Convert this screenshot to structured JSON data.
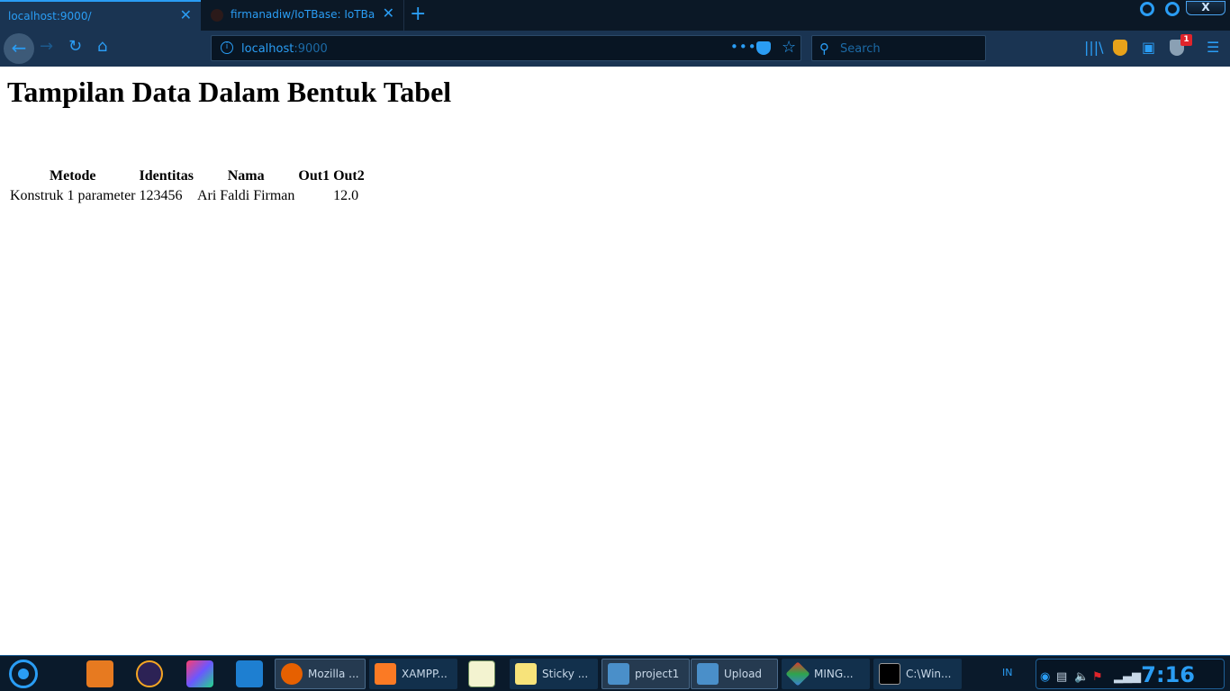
{
  "browser": {
    "tabs": [
      {
        "label": "localhost:9000/",
        "active": true
      },
      {
        "label": "firmanadiw/IoTBase: IoTBase S",
        "active": false
      }
    ],
    "window_close_label": "X",
    "url_host": "localhost",
    "url_port": ":9000",
    "search_placeholder": "Search",
    "notification_badge": "1",
    "icons": [
      "back-icon",
      "forward-icon",
      "reload-icon",
      "home-icon",
      "info-icon",
      "more-icon",
      "pocket-icon",
      "star-icon",
      "search-icon",
      "library-icon",
      "ublock-icon",
      "sidebar-icon",
      "shield-icon",
      "menu-icon"
    ]
  },
  "page": {
    "title": "Tampilan Data Dalam Bentuk Tabel",
    "table": {
      "headers": [
        "Metode",
        "Identitas",
        "Nama",
        "Out1",
        "Out2"
      ],
      "rows": [
        [
          "Konstruk 1 parameter",
          "123456",
          "Ari Faldi Firman",
          "",
          "12.0"
        ]
      ]
    }
  },
  "taskbar": {
    "items": [
      {
        "label": "Mozilla ...",
        "icon": "firefox-icon"
      },
      {
        "label": "XAMPP...",
        "icon": "xampp-icon"
      },
      {
        "label": "Sticky ...",
        "icon": "sticky-notes-icon"
      },
      {
        "label": "project1",
        "icon": "folder-icon"
      },
      {
        "label": "Upload",
        "icon": "folder-icon"
      },
      {
        "label": "MING...",
        "icon": "git-icon"
      },
      {
        "label": "C:\\Win...",
        "icon": "cmd-icon"
      }
    ],
    "language": "IN",
    "clock": "7:16"
  },
  "colors": {
    "accent": "#2a9df4",
    "chrome_dark": "#0b1826",
    "chrome_mid": "#1a3452"
  }
}
